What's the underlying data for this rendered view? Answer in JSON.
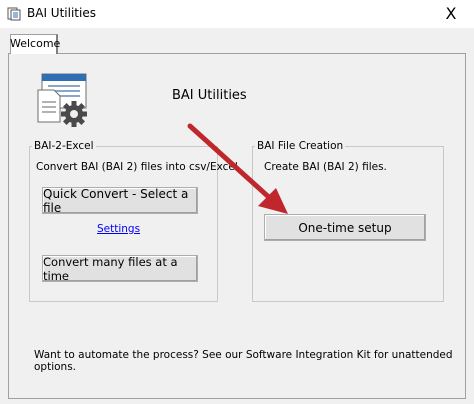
{
  "window": {
    "title": "BAI Utilities",
    "close_glyph": "X"
  },
  "tabs": [
    {
      "label": "Welcome",
      "active": true
    }
  ],
  "hero": {
    "title": "BAI Utilities",
    "icon": "document-gear-icon"
  },
  "bai2excel": {
    "legend": "BAI-2-Excel",
    "description": "Convert BAI (BAI 2) files into csv/Excel.",
    "quick_convert_label": "Quick Convert - Select a file",
    "settings_link": "Settings",
    "convert_many_label": "Convert many files at a time"
  },
  "file_creation": {
    "legend": "BAI File Creation",
    "description": "Create BAI (BAI 2) files.",
    "setup_label": "One-time setup"
  },
  "footer": {
    "text": "Want to automate the process?  See our Software Integration Kit for unattended options."
  },
  "colors": {
    "arrow": "#c0272d",
    "link": "#0000ff",
    "icon_blue": "#2f6db5"
  }
}
